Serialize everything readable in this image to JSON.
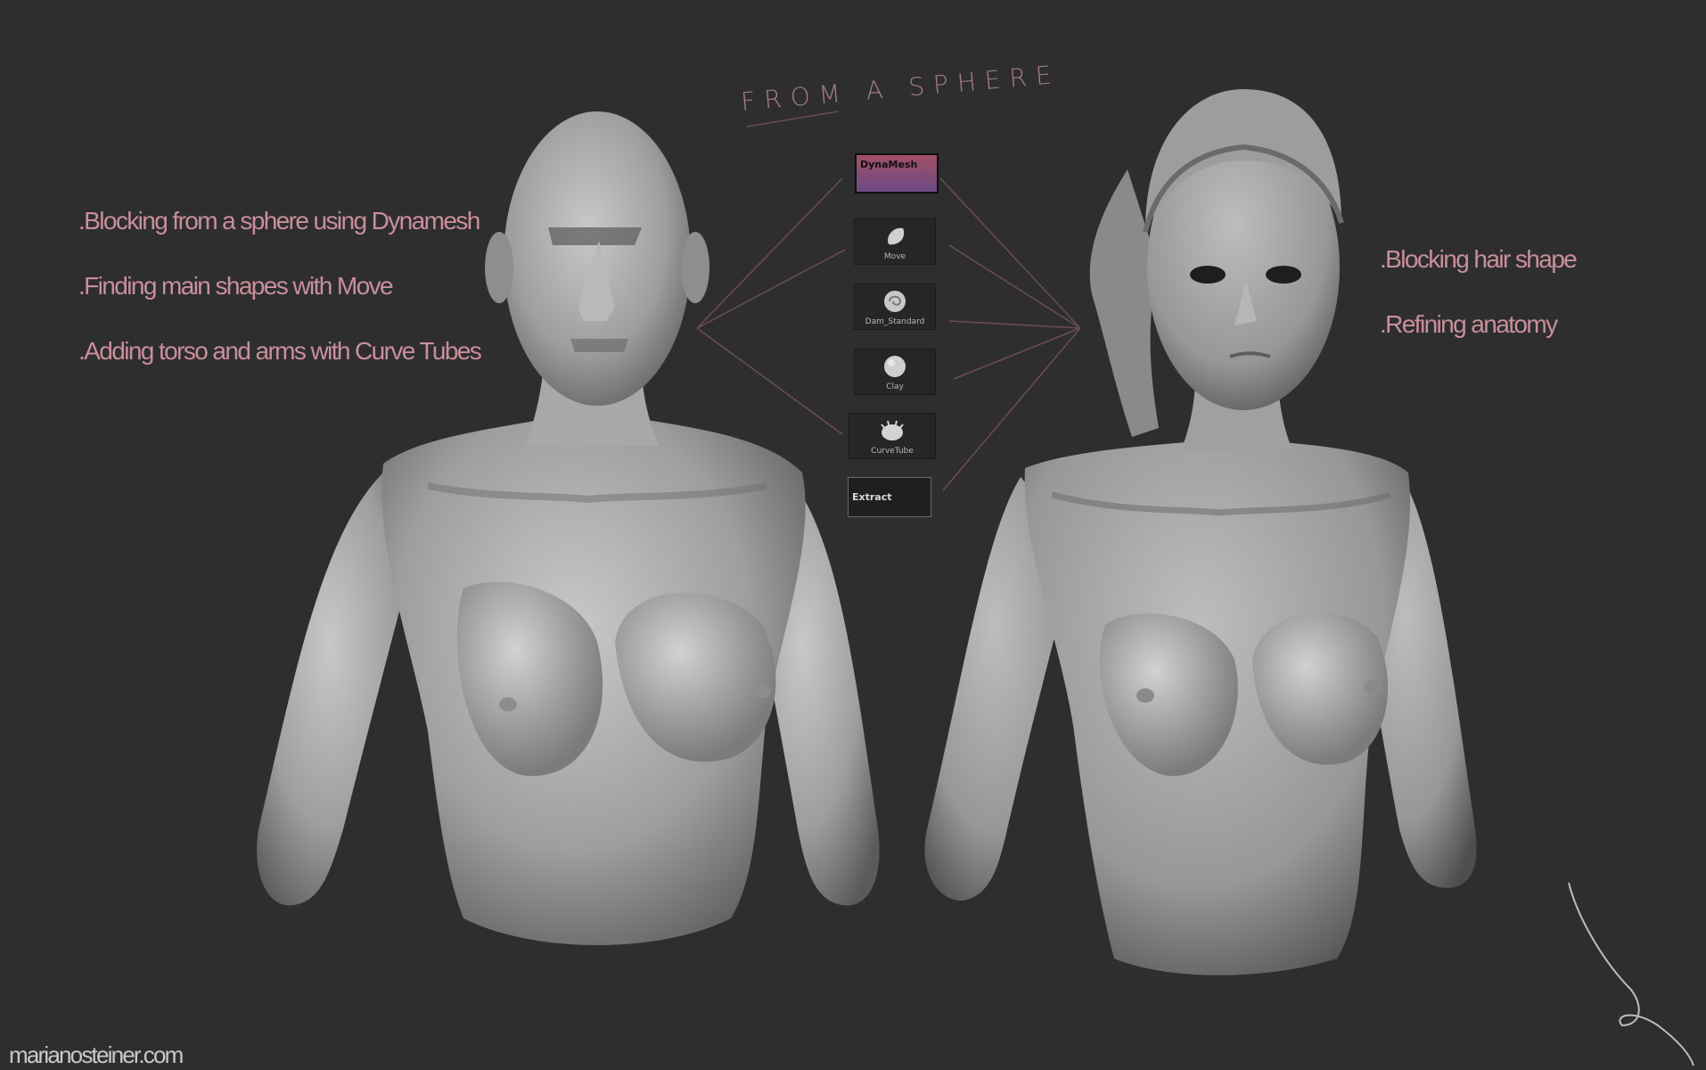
{
  "header": {
    "handwritten_title": "FROM A SPHERE"
  },
  "left_notes": [
    ".Blocking from a sphere using Dynamesh",
    ".Finding main shapes with Move",
    ".Adding torso and arms with Curve Tubes"
  ],
  "right_notes": [
    ".Blocking hair shape",
    ".Refining anatomy"
  ],
  "tools": {
    "dynamesh_label": "DynaMesh",
    "brushes": [
      "Move",
      "Dam_Standard",
      "Clay",
      "CurveTube"
    ],
    "extract_label": "Extract"
  },
  "footer": {
    "website": "marianosteiner.com"
  },
  "colors": {
    "background": "#2e2e2e",
    "note_text": "#c98e9c",
    "arrow": "#6e4c55",
    "sculpt_gray": "#a9a9a9"
  }
}
